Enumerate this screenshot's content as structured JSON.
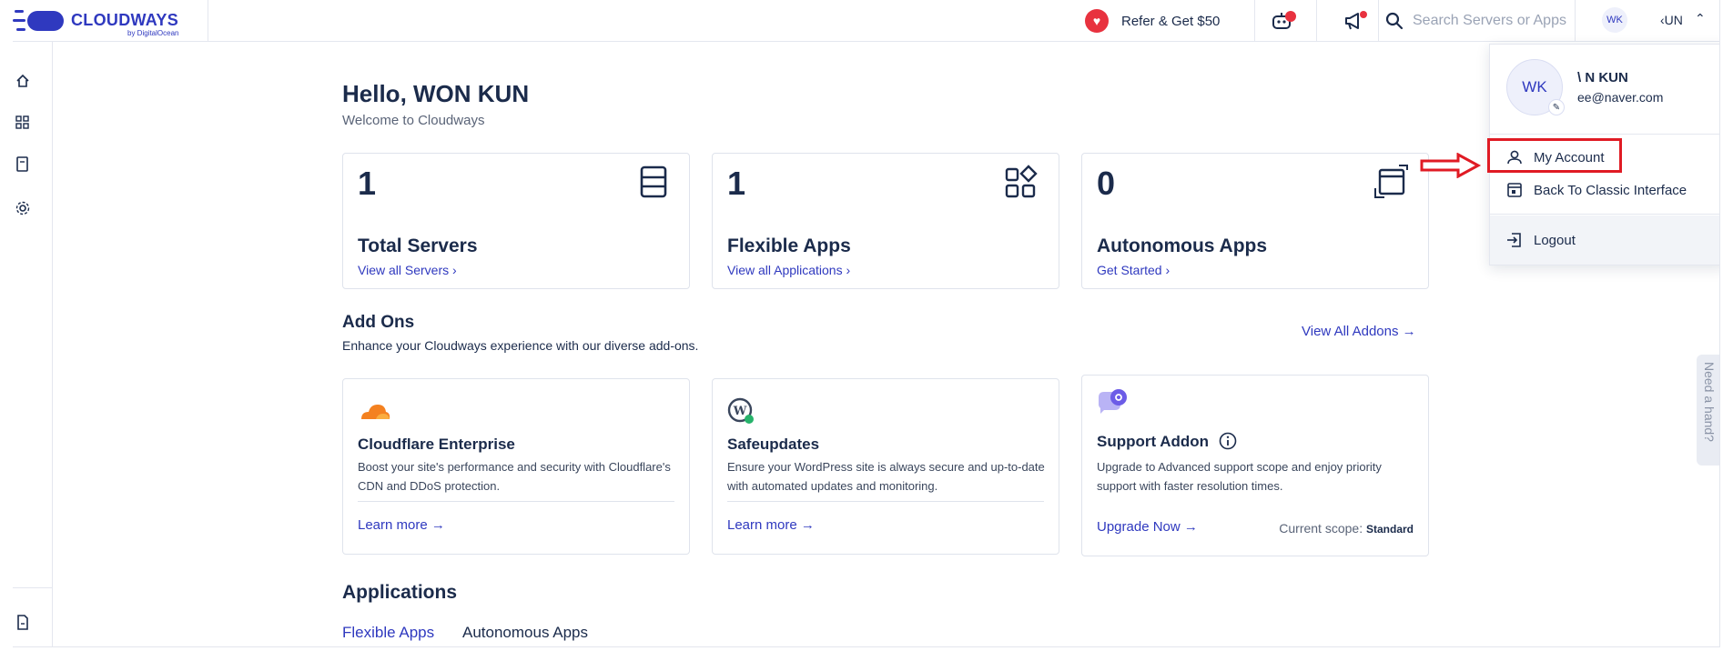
{
  "topbar": {
    "logo_text": "CLOUDWAYS",
    "logo_sub": "by DigitalOcean",
    "refer_label": "Refer & Get $50",
    "search_placeholder": "Search Servers or Apps",
    "user_initials": "WK",
    "user_name": "‹UN"
  },
  "greeting": {
    "title": "Hello, WON KUN",
    "subtitle": "Welcome to Cloudways"
  },
  "stats": [
    {
      "count": "1",
      "title": "Total Servers",
      "link": "View all Servers"
    },
    {
      "count": "1",
      "title": "Flexible Apps",
      "link": "View all Applications"
    },
    {
      "count": "0",
      "title": "Autonomous Apps",
      "link": "Get Started"
    }
  ],
  "addons": {
    "title": "Add Ons",
    "subtitle": "Enhance your Cloudways experience with our diverse add-ons.",
    "view_all": "View All Addons",
    "items": [
      {
        "title": "Cloudflare Enterprise",
        "desc": "Boost your site's performance and security with Cloudflare's CDN and DDoS protection.",
        "link": "Learn more"
      },
      {
        "title": "Safeupdates",
        "desc": "Ensure your WordPress site is always secure and up-to-date with automated updates and monitoring.",
        "link": "Learn more"
      },
      {
        "title": "Support Addon",
        "desc": "Upgrade to Advanced support scope and enjoy priority support with faster resolution times.",
        "link": "Upgrade Now",
        "scope_label": "Current scope:",
        "scope_value": "Standard"
      }
    ]
  },
  "applications": {
    "title": "Applications",
    "tabs": [
      "Flexible Apps",
      "Autonomous Apps"
    ]
  },
  "need_hand": "Need a hand?",
  "dropdown": {
    "avatar_initials": "WK",
    "name": "\\  N KUN",
    "email": "ee@naver.com",
    "items": [
      "My Account",
      "Back To Classic Interface",
      "Logout"
    ]
  },
  "colors": {
    "brand": "#2f39bf",
    "text": "#1b2b4b",
    "alert": "#e8323f",
    "annotation": "#e01b24"
  }
}
